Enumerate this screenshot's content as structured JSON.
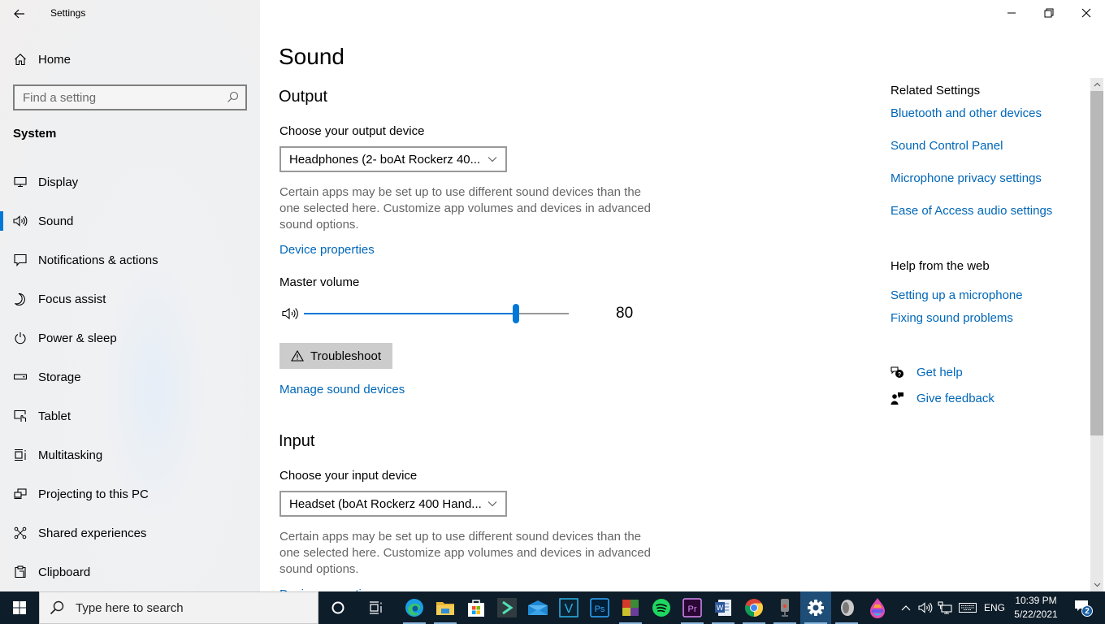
{
  "window": {
    "app_title": "Settings",
    "controls": {
      "minimize": "minimize",
      "restore": "restore",
      "close": "close"
    }
  },
  "sidebar": {
    "home_label": "Home",
    "search_placeholder": "Find a setting",
    "section_label": "System",
    "items": [
      {
        "label": "Display",
        "icon": "display-icon",
        "active": false
      },
      {
        "label": "Sound",
        "icon": "speaker-icon",
        "active": true
      },
      {
        "label": "Notifications & actions",
        "icon": "notification-icon",
        "active": false
      },
      {
        "label": "Focus assist",
        "icon": "moon-icon",
        "active": false
      },
      {
        "label": "Power & sleep",
        "icon": "power-icon",
        "active": false
      },
      {
        "label": "Storage",
        "icon": "storage-icon",
        "active": false
      },
      {
        "label": "Tablet",
        "icon": "tablet-icon",
        "active": false
      },
      {
        "label": "Multitasking",
        "icon": "multitasking-icon",
        "active": false
      },
      {
        "label": "Projecting to this PC",
        "icon": "projecting-icon",
        "active": false
      },
      {
        "label": "Shared experiences",
        "icon": "shared-experiences-icon",
        "active": false
      },
      {
        "label": "Clipboard",
        "icon": "clipboard-icon",
        "active": false
      }
    ]
  },
  "main": {
    "title": "Sound",
    "output": {
      "heading": "Output",
      "device_label": "Choose your output device",
      "device_value": "Headphones (2- boAt Rockerz 40...",
      "description": "Certain apps may be set up to use different sound devices than the one selected here. Customize app volumes and devices in advanced sound options.",
      "device_properties_link": "Device properties",
      "master_volume_label": "Master volume",
      "master_volume_value": "80",
      "master_volume_percent": 80,
      "troubleshoot_label": "Troubleshoot",
      "manage_devices_link": "Manage sound devices"
    },
    "input": {
      "heading": "Input",
      "device_label": "Choose your input device",
      "device_value": "Headset (boAt Rockerz 400 Hand...",
      "description": "Certain apps may be set up to use different sound devices than the one selected here. Customize app volumes and devices in advanced sound options.",
      "device_properties_link": "Device properties"
    }
  },
  "related": {
    "heading": "Related Settings",
    "links": [
      "Bluetooth and other devices",
      "Sound Control Panel",
      "Microphone privacy settings",
      "Ease of Access audio settings"
    ],
    "help_heading": "Help from the web",
    "help_links": [
      "Setting up a microphone",
      "Fixing sound problems"
    ],
    "get_help": "Get help",
    "give_feedback": "Give feedback"
  },
  "taskbar": {
    "search_placeholder": "Type here to search",
    "apps": [
      {
        "name": "cortana",
        "running": false
      },
      {
        "name": "task-view",
        "running": false
      },
      {
        "name": "edge",
        "running": true
      },
      {
        "name": "file-explorer",
        "running": true
      },
      {
        "name": "microsoft-store",
        "running": false
      },
      {
        "name": "filmora",
        "running": false
      },
      {
        "name": "mail",
        "running": false
      },
      {
        "name": "vegas",
        "running": false
      },
      {
        "name": "photoshop",
        "running": false
      },
      {
        "name": "winrar",
        "running": true
      },
      {
        "name": "spotify",
        "running": false
      },
      {
        "name": "premiere-pro",
        "running": true
      },
      {
        "name": "word",
        "running": true
      },
      {
        "name": "chrome",
        "running": true
      },
      {
        "name": "voice-recorder",
        "running": true
      },
      {
        "name": "settings",
        "running": true,
        "active": true
      },
      {
        "name": "audio-app",
        "running": true
      },
      {
        "name": "paint-app",
        "running": false
      }
    ],
    "language": "ENG",
    "time": "10:39 PM",
    "date": "5/22/2021",
    "notification_count": "2"
  },
  "colors": {
    "accent": "#0078d7",
    "link": "#0067b8",
    "taskbar": "#0e1d2a"
  }
}
